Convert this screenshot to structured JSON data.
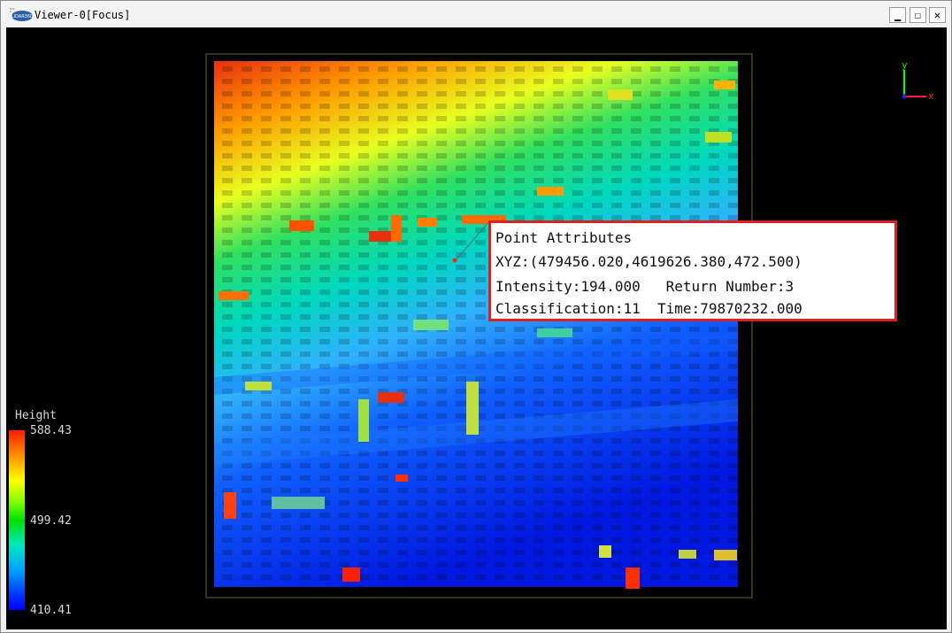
{
  "window": {
    "title": "Viewer-0[Focus]",
    "logo_text": "LIDAR360",
    "buttons": {
      "minimize": "▁",
      "maximize": "☐",
      "close": "✕"
    }
  },
  "axis": {
    "y_label": "y",
    "x_label": "x"
  },
  "popup": {
    "title": "Point Attributes",
    "xyz_line": "XYZ:(479456.020,4619626.380,472.500)",
    "intensity_return_line": "Intensity:194.000   Return Number:3",
    "classification_time_line": "Classification:11  Time:79870232.000",
    "border_color": "#e02020"
  },
  "legend": {
    "title": "Height",
    "max": "588.43",
    "mid": "499.42",
    "min": "410.41"
  }
}
